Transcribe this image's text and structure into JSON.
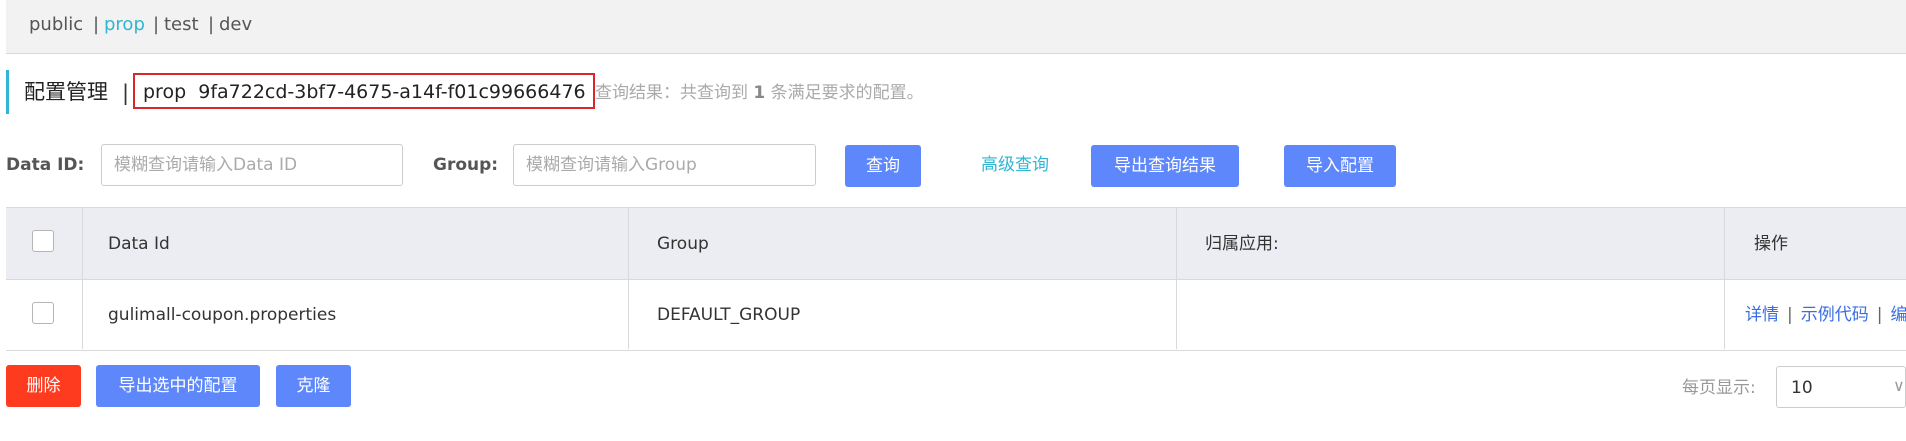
{
  "namespaces": {
    "items": [
      "public",
      "prop",
      "test",
      "dev"
    ],
    "active": "prop",
    "separator": "|"
  },
  "header": {
    "title": "配置管理",
    "divider": "|",
    "namespace_name": "prop",
    "namespace_id": "9fa722cd-3bf7-4675-a14f-f01c99666476",
    "result_prefix": "查询结果：共查询到",
    "result_count": "1",
    "result_suffix": "条满足要求的配置。"
  },
  "search": {
    "data_id_label": "Data ID:",
    "data_id_placeholder": "模糊查询请输入Data ID",
    "group_label": "Group:",
    "group_placeholder": "模糊查询请输入Group",
    "query_button": "查询",
    "advanced_link": "高级查询",
    "export_results_button": "导出查询结果",
    "import_button": "导入配置"
  },
  "table": {
    "columns": [
      "Data Id",
      "Group",
      "归属应用:",
      "操作"
    ],
    "rows": [
      {
        "data_id": "gulimall-coupon.properties",
        "group": "DEFAULT_GROUP",
        "app": "",
        "actions": [
          "详情",
          "示例代码",
          "编辑"
        ]
      }
    ]
  },
  "footer": {
    "delete_button": "删除",
    "export_selected_button": "导出选中的配置",
    "clone_button": "克隆",
    "page_size_label": "每页显示:",
    "page_size_value": "10"
  },
  "colors": {
    "accent": "#2fb6d2",
    "primary_button": "#5e87fb",
    "danger_button": "#ff3b1f",
    "highlight_border": "#d9262b"
  }
}
